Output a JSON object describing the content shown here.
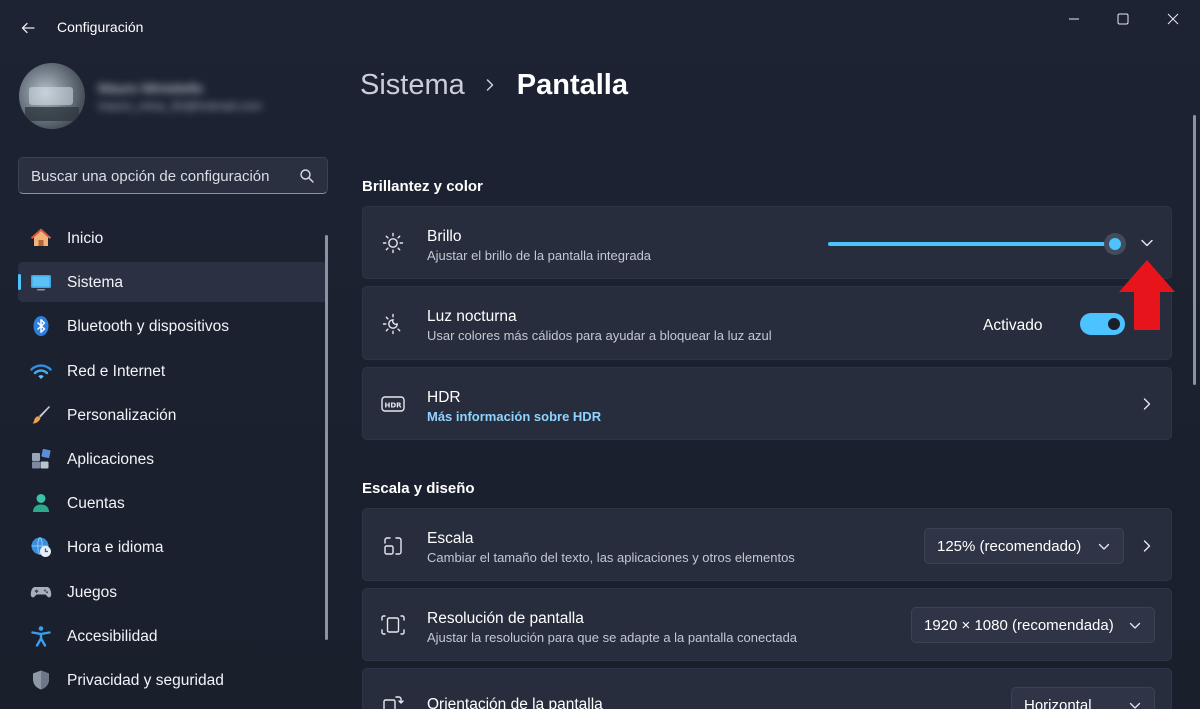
{
  "window": {
    "title": "Configuración"
  },
  "profile": {
    "name": "Mauro Ministiello",
    "email": "mauro_mina_92@hotmail.com"
  },
  "search": {
    "placeholder": "Buscar una opción de configuración"
  },
  "sidebar": {
    "items": [
      {
        "label": "Inicio",
        "icon": "home-icon"
      },
      {
        "label": "Sistema",
        "icon": "monitor-icon",
        "active": true
      },
      {
        "label": "Bluetooth y dispositivos",
        "icon": "bluetooth-icon"
      },
      {
        "label": "Red e Internet",
        "icon": "wifi-icon"
      },
      {
        "label": "Personalización",
        "icon": "brush-icon"
      },
      {
        "label": "Aplicaciones",
        "icon": "apps-icon"
      },
      {
        "label": "Cuentas",
        "icon": "person-icon"
      },
      {
        "label": "Hora e idioma",
        "icon": "globe-clock-icon"
      },
      {
        "label": "Juegos",
        "icon": "gamepad-icon"
      },
      {
        "label": "Accesibilidad",
        "icon": "accessibility-icon"
      },
      {
        "label": "Privacidad y seguridad",
        "icon": "shield-icon"
      }
    ]
  },
  "breadcrumb": {
    "parent": "Sistema",
    "current": "Pantalla"
  },
  "sections": {
    "brightness_color": {
      "title": "Brillantez y color",
      "brightness": {
        "title": "Brillo",
        "subtitle": "Ajustar el brillo de la pantalla integrada",
        "level": 0.96
      },
      "night_light": {
        "title": "Luz nocturna",
        "subtitle": "Usar colores más cálidos para ayudar a bloquear la luz azul",
        "state": "Activado"
      },
      "hdr": {
        "title": "HDR",
        "link": "Más información sobre HDR"
      }
    },
    "scale_layout": {
      "title": "Escala y diseño",
      "scale": {
        "title": "Escala",
        "subtitle": "Cambiar el tamaño del texto, las aplicaciones y otros elementos",
        "value": "125% (recomendado)"
      },
      "resolution": {
        "title": "Resolución de pantalla",
        "subtitle": "Ajustar la resolución para que se adapte a la pantalla conectada",
        "value": "1920 × 1080 (recomendada)"
      },
      "orientation": {
        "title": "Orientación de la pantalla",
        "value": "Horizontal"
      }
    }
  },
  "colors": {
    "accent": "#4cc2ff",
    "background": "#1c2230",
    "card": "#272d3c",
    "annotation_arrow": "#e8141c"
  }
}
